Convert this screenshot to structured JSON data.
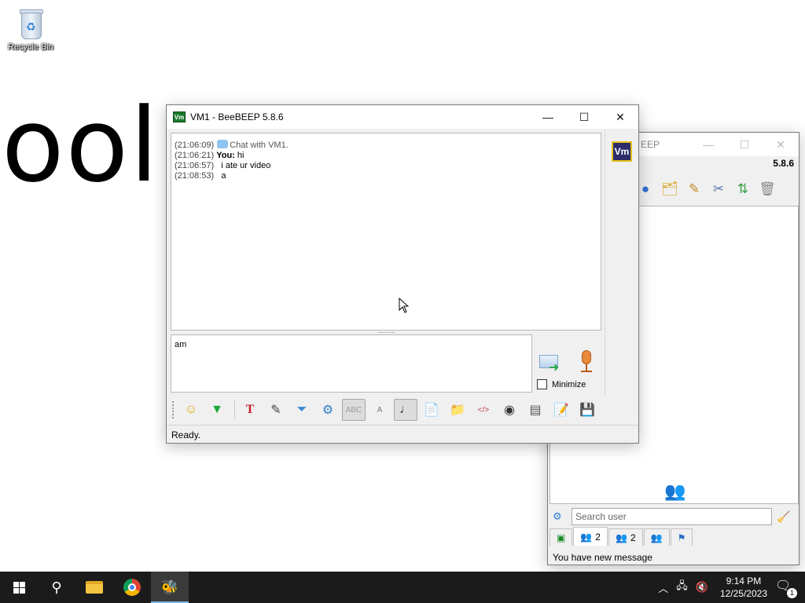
{
  "desktop": {
    "recycle_bin_label": "Recycle Bin",
    "background_text": "ool"
  },
  "chat_window": {
    "title": "VM1 - BeeBEEP 5.8.6",
    "app_icon_text": "Vm",
    "controls": {
      "minimize": "—",
      "maximize": "☐",
      "close": "✕"
    },
    "messages": [
      {
        "time": "(21:06:09)",
        "sender": "",
        "text": "Chat with VM1.",
        "system": true
      },
      {
        "time": "(21:06:21)",
        "sender": "You:",
        "text": "hi",
        "system": false
      },
      {
        "time": "(21:06:57)",
        "sender": "",
        "text": "i ate ur video",
        "system": false
      },
      {
        "time": "(21:08:53)",
        "sender": "",
        "text": "a",
        "system": false
      }
    ],
    "input_value": "am",
    "minimize_label": "Minimize",
    "side_avatar": "Vm",
    "status": "Ready."
  },
  "main_window": {
    "title_fragment": "EEP",
    "version": "5.8.6",
    "search_placeholder": "Search user",
    "tabs": [
      {
        "icon": "users-icon",
        "count": "2"
      },
      {
        "icon": "group-icon",
        "count": "2"
      },
      {
        "icon": "share-icon",
        "count": ""
      },
      {
        "icon": "flag-icon",
        "count": ""
      }
    ],
    "status": "You have new message"
  },
  "taskbar": {
    "time": "9:14 PM",
    "date": "12/25/2023",
    "notification_count": "1"
  }
}
